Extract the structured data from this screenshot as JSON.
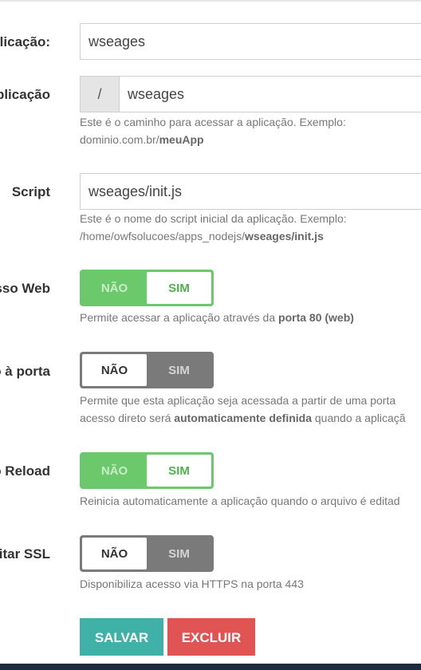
{
  "fields": {
    "app_name": {
      "label": "plicação:",
      "value": "wseages"
    },
    "app_path": {
      "label": "plicação",
      "prefix": "/",
      "value": "wseages",
      "help_text": "Este é o caminho para acessar a aplicação. Exemplo:",
      "help_prefix": "dominio.com.br/",
      "help_bold": "meuApp"
    },
    "script": {
      "label": "Script",
      "value": "wseages/init.js",
      "help_text": "Este é o nome do script inicial da aplicação. Exemplo:",
      "help_prefix": "/home/owfsolucoes/apps_nodejs/",
      "help_bold": "wseages/init.js"
    }
  },
  "toggles": {
    "web": {
      "label": "sso Web",
      "off_label": "NÃO",
      "on_label": "SIM",
      "state": "SIM",
      "help_text": "Permite acessar a aplicação através da ",
      "help_bold": "porta 80 (web)"
    },
    "port": {
      "label": "o à porta",
      "off_label": "NÃO",
      "on_label": "SIM",
      "state": "NÃO",
      "help_line1": "Permite que esta aplicação seja acessada a partir de uma porta",
      "help_line2_a": "acesso direto será ",
      "help_line2_bold": "automaticamente definida",
      "help_line2_b": " quando a aplicaçã"
    },
    "reload": {
      "label": "o Reload",
      "off_label": "NÃO",
      "on_label": "SIM",
      "state": "SIM",
      "help_text": "Reinicia automaticamente a aplicação quando o arquivo é editad"
    },
    "ssl": {
      "label": "itar SSL",
      "off_label": "NÃO",
      "on_label": "SIM",
      "state": "NÃO",
      "help_text": "Disponibiliza acesso via HTTPS na porta 443"
    }
  },
  "actions": {
    "save": "SALVAR",
    "delete": "EXCLUIR"
  },
  "colors": {
    "toggle_on": "#6cc96b",
    "toggle_off": "#7a7a7a",
    "save": "#3fb1a7",
    "delete": "#e05454"
  }
}
